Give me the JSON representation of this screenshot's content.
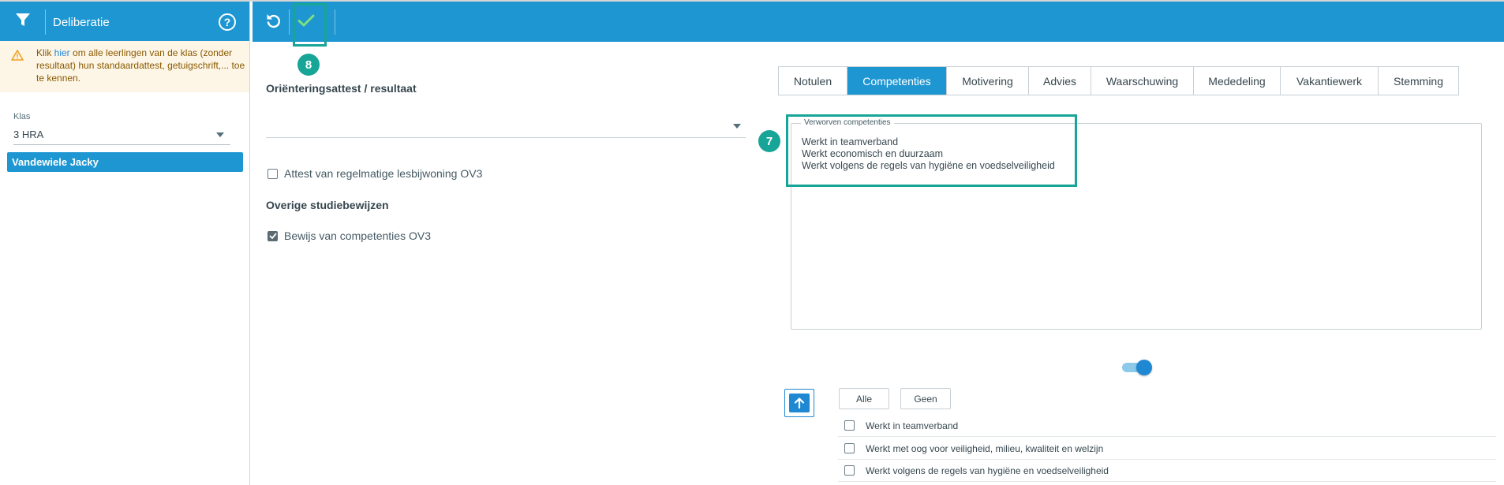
{
  "sidebar": {
    "title": "Deliberatie",
    "help_symbol": "?",
    "filter_icon": "filter-icon",
    "warning": {
      "prefix": "Klik ",
      "link": "hier",
      "suffix": " om alle leerlingen van de klas (zonder resultaat) hun standaardattest, getuigschrift,... toe te kennen."
    },
    "klas_label": "Klas",
    "klas_value": "3 HRA",
    "selected_student": "Vandewiele Jacky"
  },
  "toolbar": {
    "undo_icon": "undo-icon",
    "save_icon": "check-icon"
  },
  "callouts": {
    "save": "8",
    "competencies": "7"
  },
  "content": {
    "orientation_title": "Oriënteringsattest / resultaat",
    "orientation_value": "",
    "attendance_checkbox": {
      "label": "Attest van regelmatige lesbijwoning OV3",
      "checked": false
    },
    "other_certificates_title": "Overige studiebewijzen",
    "competence_proof_checkbox": {
      "label": "Bewijs van competenties OV3",
      "checked": true
    }
  },
  "tabs": [
    "Notulen",
    "Competenties",
    "Motivering",
    "Advies",
    "Waarschuwing",
    "Mededeling",
    "Vakantiewerk",
    "Stemming"
  ],
  "active_tab": "Competenties",
  "acquired": {
    "legend": "Verworven competenties",
    "lines": [
      "Werkt in teamverband",
      "Werkt economisch en duurzaam",
      "Werkt volgens de regels van hygiëne en voedselveiligheid"
    ]
  },
  "toggle_on": true,
  "competence_list": {
    "all_label": "Alle",
    "none_label": "Geen",
    "items": [
      {
        "label": "Werkt in teamverband",
        "checked": false
      },
      {
        "label": "Werkt met oog voor veiligheid, milieu, kwaliteit en welzijn",
        "checked": false
      },
      {
        "label": "Werkt volgens de regels van hygiëne en voedselveiligheid",
        "checked": false
      }
    ]
  },
  "colors": {
    "primary": "#1e96d2",
    "callout": "#17a597",
    "warning_bg": "#fdf5e6"
  }
}
